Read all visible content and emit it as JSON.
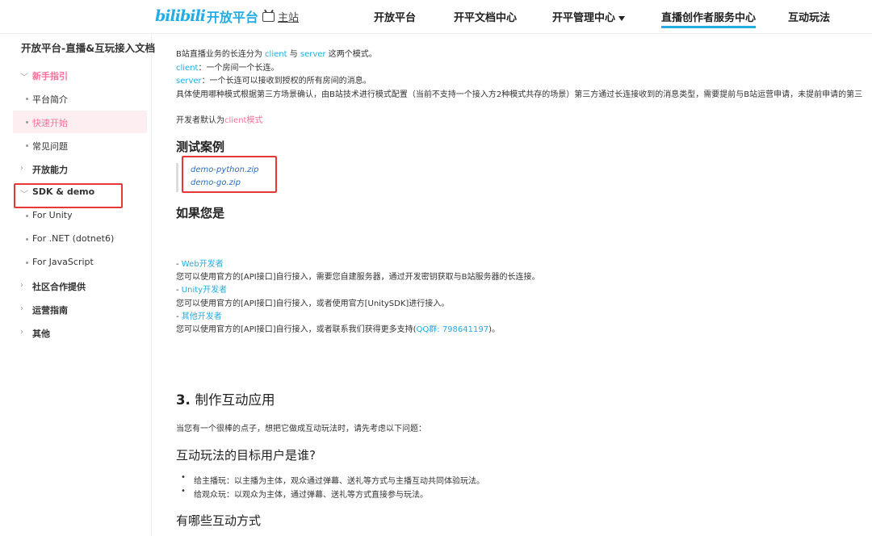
{
  "topnav": {
    "logo_mark": "bilibili",
    "logo_text": "开放平台",
    "home_label": "主站",
    "items": [
      "开放平台",
      "开平文档中心",
      "开平管理中心",
      "直播创作者服务中心",
      "互动玩法"
    ]
  },
  "sidebar": {
    "title": "开放平台-直播&互玩接入文档",
    "items": [
      {
        "label": "新手指引"
      },
      {
        "label": "平台简介"
      },
      {
        "label": "快速开始"
      },
      {
        "label": "常见问题"
      },
      {
        "label": "开放能力"
      },
      {
        "label": "SDK & demo"
      },
      {
        "label": "For Unity"
      },
      {
        "label": "For .NET (dotnet6)"
      },
      {
        "label": "For JavaScript"
      },
      {
        "label": "社区合作提供"
      },
      {
        "label": "运营指南"
      },
      {
        "label": "其他"
      }
    ]
  },
  "content": {
    "intro": {
      "pre": "B站直播业务的长连分为 ",
      "client": "client",
      "mid": " 与 ",
      "server": "server",
      "post": " 这两个模式。"
    },
    "client_line": {
      "key": "client",
      "text": "：一个房间一个长连。"
    },
    "server_line": {
      "key": "server",
      "text": "：一个长连可以接收到授权的所有房间的消息。"
    },
    "detail_line": "具体使用哪种模式根据第三方场景确认，由B站技术进行模式配置（当前不支持一个接入方2种模式共存的场景）第三方通过长连接收到的消息类型，需要提前与B站运营申请，未提前申请的第三",
    "default_line": {
      "pre": "开发者默认为",
      "mode": "client模式"
    },
    "test_heading": "测试案例",
    "downloads": [
      "demo-python.zip",
      "demo-go.zip"
    ],
    "if_heading": "如果您是",
    "dev_types": [
      {
        "label": "Web开发者",
        "desc": "您可以使用官方的[API接口]自行接入，需要您自建服务器，通过开发密钥获取与B站服务器的长连接。"
      },
      {
        "label": "Unity开发者",
        "desc": "您可以使用官方的[API接口]自行接入，或者使用官方[UnitySDK]进行接入。"
      },
      {
        "label": "其他开发者",
        "desc_pre": "您可以使用官方的[API接口]自行接入，或者联系我们获得更多支持(",
        "qq": "QQ群: 798641197",
        "desc_post": ")。"
      }
    ],
    "section3": {
      "num": "3.",
      "title": "制作互动应用"
    },
    "section3_intro": "当您有一个很棒的点子，想把它做成互动玩法时，请先考虑以下问题：",
    "target_heading": "互动玩法的目标用户是谁?",
    "target_bullets": [
      "给主播玩：以主播为主体，观众通过弹幕、送礼等方式与主播互动共同体验玩法。",
      "给观众玩：以观众为主体，通过弹幕、送礼等方式直接参与玩法。"
    ],
    "ways_heading": "有哪些互动方式"
  },
  "colors": {
    "brand": "#23ade5",
    "accent_pink": "#fb7299",
    "highlight_red": "#e53935"
  }
}
